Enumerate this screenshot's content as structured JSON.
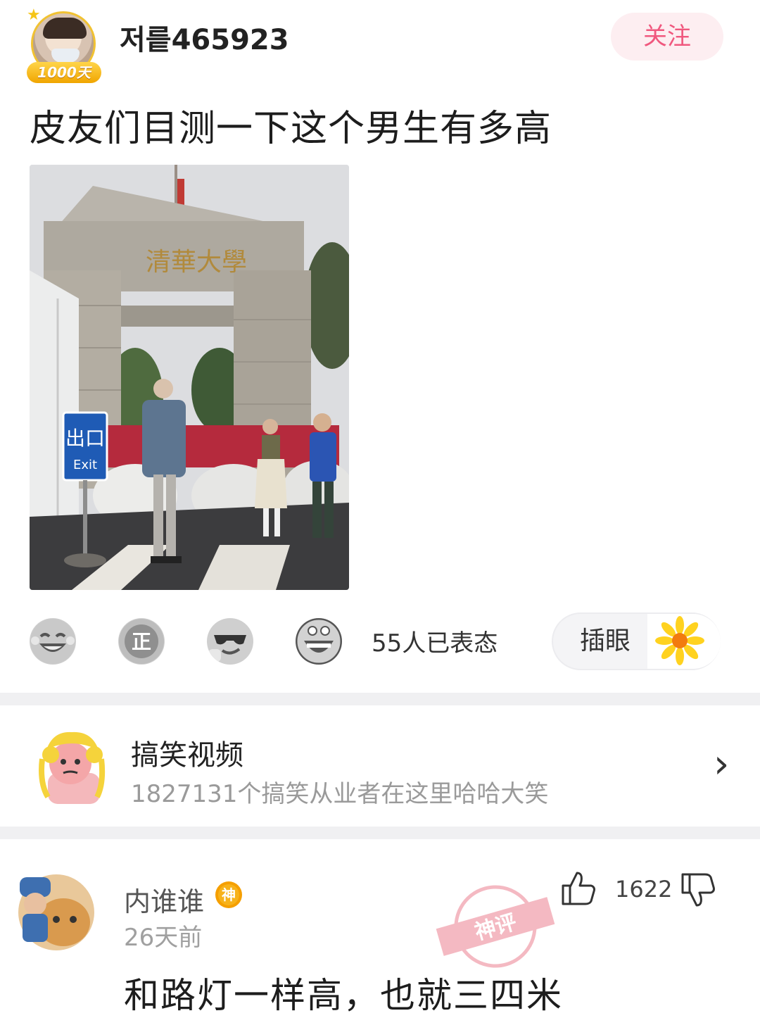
{
  "post": {
    "author": {
      "name": "저릍465923",
      "badge": "1000天"
    },
    "follow_label": "关注",
    "text": "皮友们目测一下这个男生有多高",
    "image": {
      "sign_text_top": "出口",
      "sign_text_bottom": "Exit",
      "gate_inscription": "清華大學"
    },
    "reactions": {
      "count_text": "55人已表态",
      "icons": [
        "laughing-face-icon",
        "zheng-badge-icon",
        "cool-sunglasses-face-icon",
        "grinning-face-icon"
      ],
      "chayan_label": "插眼"
    }
  },
  "topic": {
    "title": "搞笑视频",
    "subtitle": "1827131个搞笑从业者在这里哈哈大笑"
  },
  "comment": {
    "author": "内谁谁",
    "badge": "神",
    "time": "26天前",
    "likes": "1622",
    "stamp_text": "神评",
    "text": "和路灯一样高，也就三四米"
  },
  "colors": {
    "accent_pink": "#f0587e",
    "badge_gold": "#f5a400",
    "divider": "#f0f0f2"
  }
}
